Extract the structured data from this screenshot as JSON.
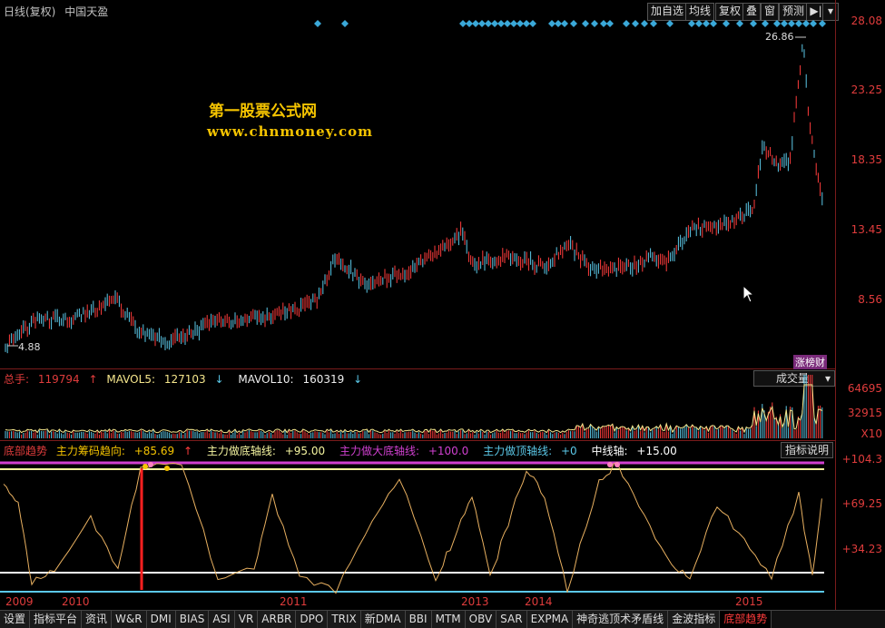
{
  "header": {
    "period": "日线(复权)",
    "stock": "中国天盈",
    "buttons": [
      "加自选",
      "均线",
      "复权",
      "叠",
      "窗",
      "预测"
    ]
  },
  "price_axis": [
    "28.08",
    "23.25",
    "18.35",
    "13.45",
    "8.56"
  ],
  "annotations": {
    "high": "26.86",
    "low": "4.88",
    "badge": "涨榜财"
  },
  "watermark": {
    "line1": "第一股票公式网",
    "line2": "www.chnmoney.com"
  },
  "volume": {
    "label_total": "总手:",
    "total": "119794",
    "ma5_label": "MAVOL5:",
    "ma5": "127103",
    "ma10_label": "MAVOL10:",
    "ma10": "160319",
    "dropdown": "成交量",
    "axis": [
      "64695",
      "32915",
      "X10"
    ]
  },
  "indicator": {
    "name": "底部趋势",
    "items": [
      {
        "label": "主力筹码趋向:",
        "value": "+85.69",
        "color": "#f5c400"
      },
      {
        "label": "主力做底轴线:",
        "value": "+95.00",
        "color": "#f5f5a0"
      },
      {
        "label": "主力做大底轴线:",
        "value": "+100.0",
        "color": "#d040d0"
      },
      {
        "label": "主力做顶轴线:",
        "value": "+0",
        "color": "#5bc8e8"
      },
      {
        "label": "中线轴:",
        "value": "+15.00",
        "color": "#ffffff"
      }
    ],
    "help_button": "指标说明",
    "axis": [
      "+104.3",
      "+69.25",
      "+34.23"
    ]
  },
  "years": [
    "2009",
    "2010",
    "2011",
    "2013",
    "2014",
    "2015"
  ],
  "tabs": [
    "设置",
    "指标平台",
    "资讯",
    "W&R",
    "DMI",
    "BIAS",
    "ASI",
    "VR",
    "ARBR",
    "DPO",
    "TRIX",
    "新DMA",
    "BBI",
    "MTM",
    "OBV",
    "SAR",
    "EXPMA",
    "神奇逃顶术矛盾线",
    "金波指标",
    "底部趋势"
  ],
  "colors": {
    "up": "#ff3c3c",
    "down": "#5bc8e8",
    "accent": "#f5c400"
  }
}
